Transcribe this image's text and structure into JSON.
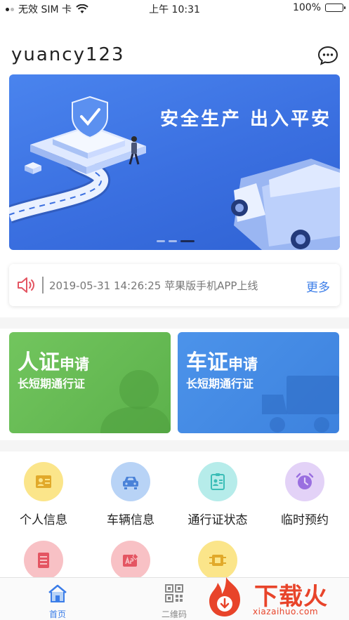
{
  "status_bar": {
    "carrier": "无效 SIM 卡",
    "time": "上午 10:31",
    "battery": "100%"
  },
  "header": {
    "username": "yuancy123",
    "message_icon": "chat-bubble-icon"
  },
  "banner": {
    "title": "安全生产 出入平安",
    "slide_count": 3,
    "active_slide": 3
  },
  "notice": {
    "icon": "speaker-icon",
    "text": "2019-05-31 14:26:25 苹果版手机APP上线",
    "more_label": "更多"
  },
  "cards": [
    {
      "title_big": "人证",
      "title_small": "申请",
      "subtitle": "长短期通行证",
      "color": "#6abc58"
    },
    {
      "title_big": "车证",
      "title_small": "申请",
      "subtitle": "长短期通行证",
      "color": "#4589e5"
    }
  ],
  "features": [
    {
      "label": "个人信息",
      "icon": "id-card-icon",
      "bg": "#fbe58a",
      "fg": "#e1a92a"
    },
    {
      "label": "车辆信息",
      "icon": "car-icon",
      "bg": "#b8d3f6",
      "fg": "#4a82d8"
    },
    {
      "label": "通行证状态",
      "icon": "badge-icon",
      "bg": "#b6ecea",
      "fg": "#3bbdb7"
    },
    {
      "label": "临时预约",
      "icon": "clock-icon",
      "bg": "#e3d2f7",
      "fg": "#9a6fe0"
    },
    {
      "label": "",
      "icon": "document-icon",
      "bg": "#f8c1c5",
      "fg": "#e45562"
    },
    {
      "label": "",
      "icon": "edit-icon",
      "bg": "#f8c1c5",
      "fg": "#e45562"
    },
    {
      "label": "",
      "icon": "chip-icon",
      "bg": "#fbe58a",
      "fg": "#e1a92a"
    }
  ],
  "tabbar": {
    "tabs": [
      {
        "label": "首页",
        "icon": "home-icon",
        "active": true,
        "color": "#3b7de8"
      },
      {
        "label": "二维码",
        "icon": "qr-code-icon",
        "active": false,
        "color": "#888888"
      }
    ]
  },
  "watermark": {
    "title": "下载火",
    "subtitle": "xiazaihuo.com"
  }
}
